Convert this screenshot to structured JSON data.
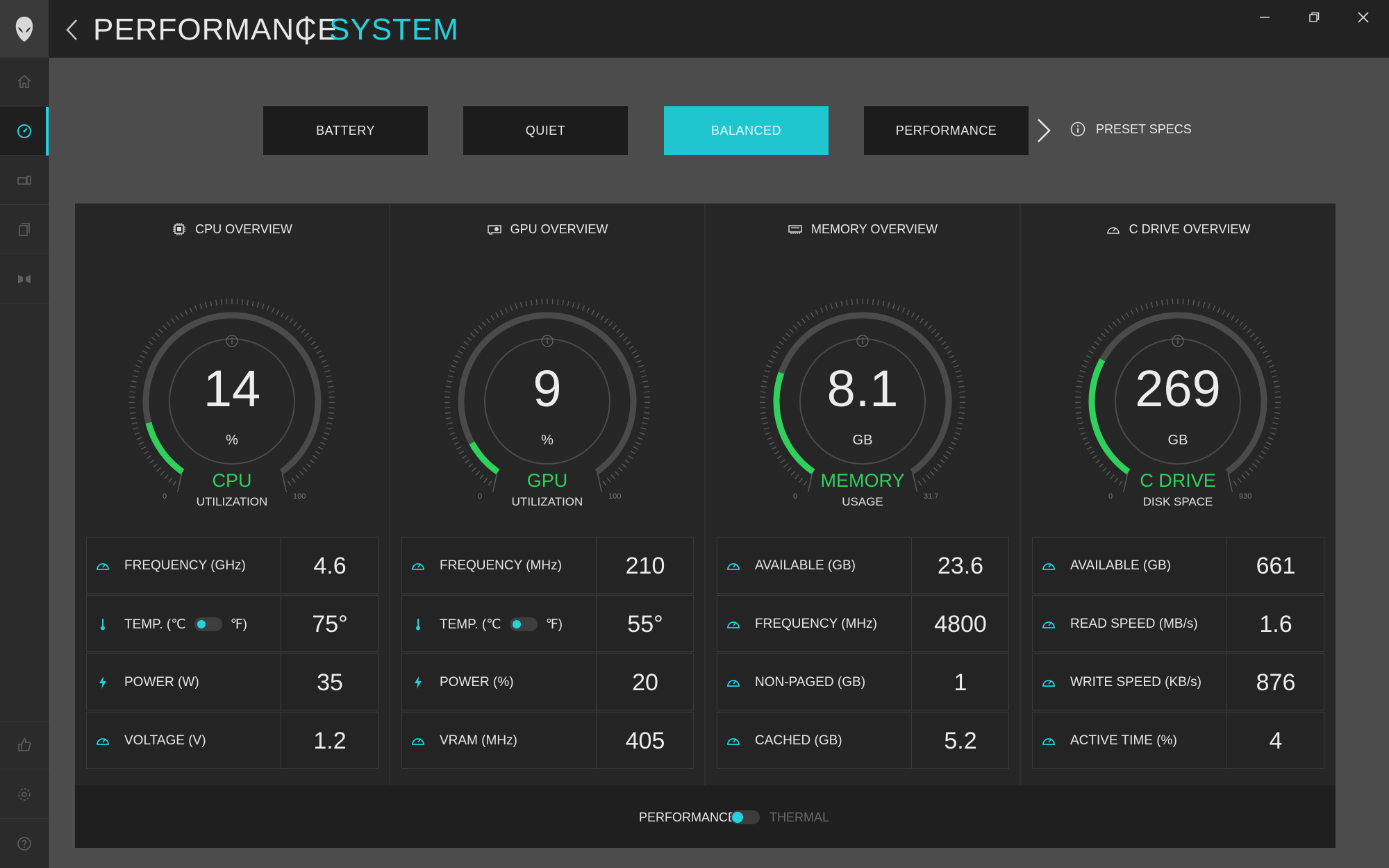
{
  "window": {
    "title": "PERFORMANCE",
    "separator": "|",
    "subtitle": "SYSTEM"
  },
  "colors": {
    "accent": "#22d3de",
    "gauge_fill": "#2fd15c",
    "panel": "#262626"
  },
  "sidebar": {
    "items": [
      {
        "icon": "home-icon"
      },
      {
        "icon": "gauge-icon",
        "active": true
      },
      {
        "icon": "devices-icon"
      },
      {
        "icon": "library-icon"
      },
      {
        "icon": "fusion-icon"
      },
      {
        "icon": "thumbs-up-icon"
      },
      {
        "icon": "gear-icon"
      },
      {
        "icon": "help-icon"
      }
    ]
  },
  "presets": {
    "items": [
      "BATTERY",
      "QUIET",
      "BALANCED",
      "PERFORMANCE"
    ],
    "active": "BALANCED",
    "specs_label": "PRESET SPECS"
  },
  "columns": [
    {
      "header": "CPU OVERVIEW",
      "gauge": {
        "value": "14",
        "unit": "%",
        "label": "CPU",
        "sub": "UTILIZATION",
        "min": "0",
        "max": "100",
        "fraction": 0.14
      },
      "stats": [
        {
          "label": "FREQUENCY (GHz)",
          "value": "4.6",
          "icon": "speedometer-icon"
        },
        {
          "label": "TEMP. (℃",
          "label_end": "℉)",
          "value": "75°",
          "icon": "thermometer-icon",
          "toggle": true
        },
        {
          "label": "POWER (W)",
          "value": "35",
          "icon": "lightning-icon"
        },
        {
          "label": "VOLTAGE (V)",
          "value": "1.2",
          "icon": "speedometer-icon"
        }
      ]
    },
    {
      "header": "GPU OVERVIEW",
      "gauge": {
        "value": "9",
        "unit": "%",
        "label": "GPU",
        "sub": "UTILIZATION",
        "min": "0",
        "max": "100",
        "fraction": 0.09
      },
      "stats": [
        {
          "label": "FREQUENCY (MHz)",
          "value": "210",
          "icon": "speedometer-icon"
        },
        {
          "label": "TEMP. (℃",
          "label_end": "℉)",
          "value": "55°",
          "icon": "thermometer-icon",
          "toggle": true
        },
        {
          "label": "POWER (%)",
          "value": "20",
          "icon": "lightning-icon"
        },
        {
          "label": "VRAM (MHz)",
          "value": "405",
          "icon": "speedometer-icon"
        }
      ]
    },
    {
      "header": "MEMORY OVERVIEW",
      "gauge": {
        "value": "8.1",
        "unit": "GB",
        "label": "MEMORY",
        "sub": "USAGE",
        "min": "0",
        "max": "31.7",
        "fraction": 0.256
      },
      "stats": [
        {
          "label": "AVAILABLE (GB)",
          "value": "23.6",
          "icon": "speedometer-icon"
        },
        {
          "label": "FREQUENCY (MHz)",
          "value": "4800",
          "icon": "speedometer-icon"
        },
        {
          "label": "NON-PAGED (GB)",
          "value": "1",
          "icon": "speedometer-icon"
        },
        {
          "label": "CACHED (GB)",
          "value": "5.2",
          "icon": "speedometer-icon"
        }
      ]
    },
    {
      "header": "C DRIVE OVERVIEW",
      "gauge": {
        "value": "269",
        "unit": "GB",
        "label": "C DRIVE",
        "sub": "DISK SPACE",
        "min": "0",
        "max": "930",
        "fraction": 0.289
      },
      "stats": [
        {
          "label": "AVAILABLE (GB)",
          "value": "661",
          "icon": "speedometer-icon"
        },
        {
          "label": "READ SPEED (MB/s)",
          "value": "1.6",
          "icon": "speedometer-icon"
        },
        {
          "label": "WRITE SPEED (KB/s)",
          "value": "876",
          "icon": "speedometer-icon"
        },
        {
          "label": "ACTIVE TIME (%)",
          "value": "4",
          "icon": "speedometer-icon"
        }
      ]
    }
  ],
  "footer": {
    "left_label": "PERFORMANCE",
    "right_label": "THERMAL"
  }
}
